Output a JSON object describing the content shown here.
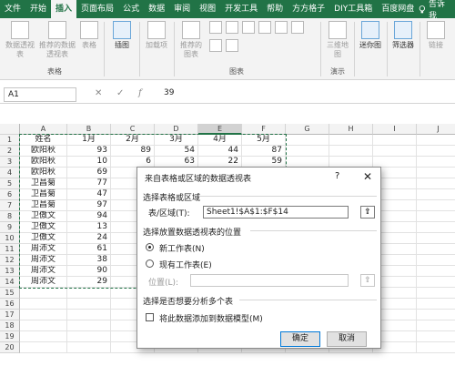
{
  "tabs": [
    "文件",
    "开始",
    "插入",
    "页面布局",
    "公式",
    "数据",
    "审阅",
    "视图",
    "开发工具",
    "帮助",
    "方方格子",
    "DIY工具箱",
    "百度网盘"
  ],
  "tell": "告诉我",
  "ribbon": {
    "pivot": "数据透视表",
    "recommended": "推荐的数据透视表",
    "table": "表格",
    "illustrations": "插图",
    "addins": "加载项",
    "rec_charts": "推荐的图表",
    "map3d": "三维地图",
    "sparklines": "迷你图",
    "filter": "筛选器",
    "link": "链接",
    "groups": {
      "tables": "表格",
      "charts": "图表",
      "tours": "演示"
    }
  },
  "formula": {
    "name_box": "A1",
    "value": "39"
  },
  "columns": [
    "A",
    "B",
    "C",
    "D",
    "E",
    "F",
    "G",
    "H",
    "I",
    "J"
  ],
  "rows": [
    "1",
    "2",
    "3",
    "4",
    "5",
    "6",
    "7",
    "8",
    "9",
    "10",
    "11",
    "12",
    "13",
    "14",
    "15",
    "16",
    "17",
    "18",
    "19",
    "20"
  ],
  "sheet": [
    [
      "姓名",
      "1月",
      "2月",
      "3月",
      "4月",
      "5月"
    ],
    [
      "欧阳秋",
      "93",
      "89",
      "54",
      "44",
      "87"
    ],
    [
      "欧阳秋",
      "10",
      "6",
      "63",
      "22",
      "59"
    ],
    [
      "欧阳秋",
      "69",
      "50",
      "",
      "",
      ""
    ],
    [
      "卫昌菊",
      "77",
      "47",
      "",
      "",
      ""
    ],
    [
      "卫昌菊",
      "47",
      "97",
      "",
      "",
      ""
    ],
    [
      "卫昌菊",
      "97",
      "64",
      "",
      "",
      ""
    ],
    [
      "卫傲文",
      "94",
      "51",
      "",
      "",
      ""
    ],
    [
      "卫傲文",
      "13",
      "1",
      "",
      "",
      ""
    ],
    [
      "卫傲文",
      "24",
      "29",
      "",
      "",
      ""
    ],
    [
      "周沛文",
      "61",
      "59",
      "",
      "",
      ""
    ],
    [
      "周沛文",
      "38",
      "16",
      "",
      "",
      ""
    ],
    [
      "周沛文",
      "90",
      "87",
      "",
      "",
      ""
    ],
    [
      "周沛文",
      "29",
      "20",
      "",
      "",
      ""
    ]
  ],
  "dialog": {
    "title": "来自表格或区域的数据透视表",
    "help": "?",
    "close": "✕",
    "section1": "选择表格或区域",
    "range_label": "表/区域(T):",
    "range_value": "Sheet1!$A$1:$F$14",
    "section2": "选择放置数据透视表的位置",
    "opt_new": "新工作表(N)",
    "opt_existing": "现有工作表(E)",
    "location_label": "位置(L):",
    "section3": "选择是否想要分析多个表",
    "add_model": "将此数据添加到数据模型(M)",
    "ok": "确定",
    "cancel": "取消"
  }
}
